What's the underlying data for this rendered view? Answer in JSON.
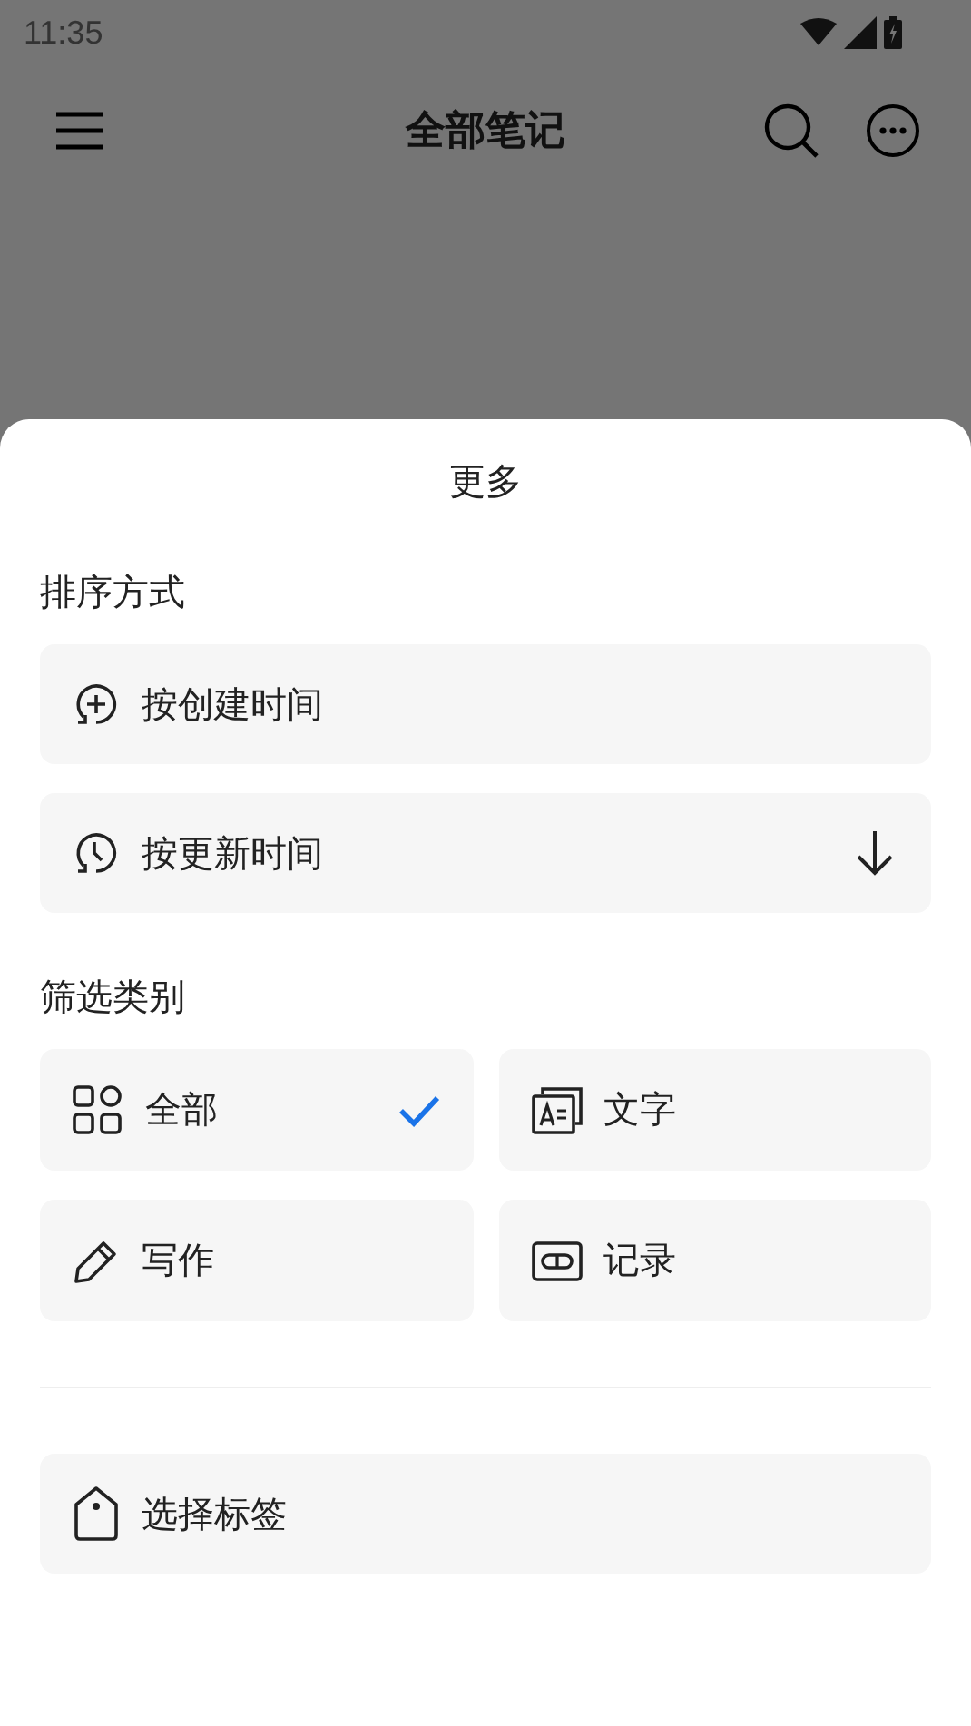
{
  "status_bar": {
    "time": "11:35"
  },
  "app_bar": {
    "title": "全部笔记"
  },
  "sheet": {
    "title": "更多",
    "sort_heading": "排序方式",
    "sort_options": [
      {
        "label": "按创建时间",
        "selected": false
      },
      {
        "label": "按更新时间",
        "selected": true
      }
    ],
    "filter_heading": "筛选类别",
    "categories": [
      {
        "label": "全部",
        "selected": true
      },
      {
        "label": "文字",
        "selected": false
      },
      {
        "label": "写作",
        "selected": false
      },
      {
        "label": "记录",
        "selected": false
      }
    ],
    "tag_button": {
      "label": "选择标签"
    }
  }
}
